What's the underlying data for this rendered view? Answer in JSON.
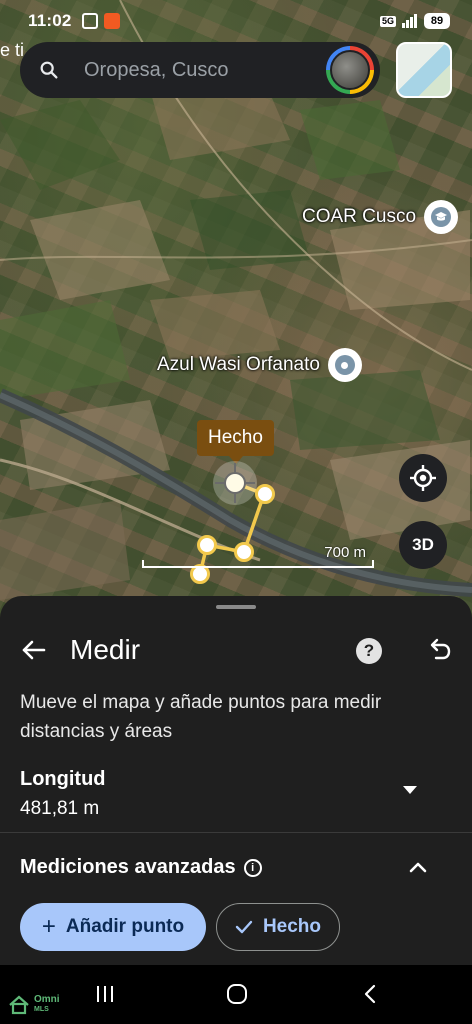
{
  "status_bar": {
    "time": "11:02",
    "network": "5G",
    "battery": "89"
  },
  "search": {
    "placeholder": "Oropesa, Cusco"
  },
  "map": {
    "edge_text": "e ti",
    "places": [
      {
        "name": "COAR Cusco",
        "icon": "school-pin-icon"
      },
      {
        "name": "Azul Wasi Orfanato",
        "icon": "place-pin-icon"
      }
    ],
    "tooltip": "Hecho",
    "button_3d": "3D",
    "scale": "700 m"
  },
  "measure": {
    "title": "Medir",
    "description": "Mueve el mapa y añade puntos para medir distancias y áreas",
    "length_label": "Longitud",
    "length_value": "481,81 m",
    "advanced_label": "Mediciones avanzadas",
    "add_point_label": "Añadir punto",
    "done_label": "Hecho"
  },
  "watermark": {
    "line1": "Omni",
    "line2": "MLS"
  },
  "colors": {
    "accent": "#a8c7fa",
    "measure_line": "#f2c94c",
    "sheet": "#1f1f1f"
  }
}
